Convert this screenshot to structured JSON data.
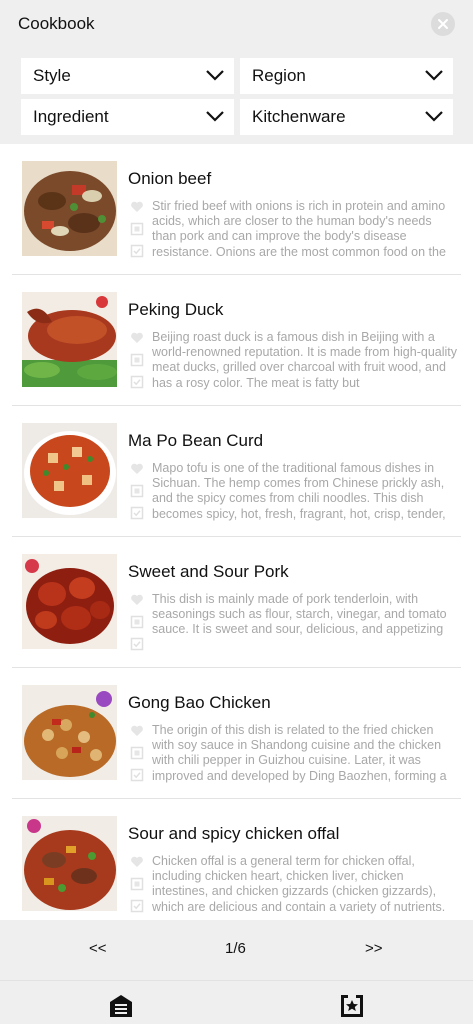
{
  "header": {
    "title": "Cookbook"
  },
  "filters": [
    {
      "label": "Style"
    },
    {
      "label": "Region"
    },
    {
      "label": "Ingredient"
    },
    {
      "label": "Kitchenware"
    }
  ],
  "dishes": [
    {
      "title": "Onion beef",
      "description": "Stir fried beef with onions is rich in protein and amino acids, which are closer to the human body's needs than pork and can improve the body's disease resistance. Onions are the most common food on the"
    },
    {
      "title": "Peking Duck",
      "description": "Beijing roast duck is a famous dish in Beijing with a world-renowned reputation. It is made from high-quality meat ducks, grilled over charcoal with fruit wood, and has a rosy color. The meat is fatty but"
    },
    {
      "title": "Ma Po Bean Curd",
      "description": "Mapo tofu is one of the traditional famous dishes in Sichuan. The hemp comes from Chinese prickly ash, and the spicy comes from chili noodles. This dish becomes spicy, hot, fresh, fragrant, hot, crisp, tender,"
    },
    {
      "title": "Sweet and Sour Pork",
      "description": "This dish is mainly made of pork tenderloin, with seasonings such as flour, starch, vinegar, and tomato sauce. It is sweet and sour, delicious, and appetizing"
    },
    {
      "title": "Gong Bao Chicken",
      "description": "The origin of this dish is related to the fried chicken with soy sauce in Shandong cuisine and the chicken with chili pepper in Guizhou cuisine. Later, it was improved and developed by Ding Baozhen, forming a"
    },
    {
      "title": "Sour and spicy chicken offal",
      "description": "Chicken offal is a general term for chicken offal, including chicken heart, chicken liver, chicken intestines, and chicken gizzards (chicken gizzards), which are delicious and contain a variety of nutrients."
    }
  ],
  "pager": {
    "prev": "<<",
    "page": "1/6",
    "next": ">>"
  },
  "icons": {
    "close": "close-icon",
    "chevron": "chevron-down-icon",
    "favorite": "heart-icon",
    "note": "square-icon",
    "check": "checkbox-icon",
    "tab_left": "menu-list-icon",
    "tab_right": "star-card-icon"
  },
  "colors": {
    "bar": "#efefef",
    "text": "#111111",
    "muted": "#a8a8a8",
    "divider": "#e3e3e3"
  }
}
